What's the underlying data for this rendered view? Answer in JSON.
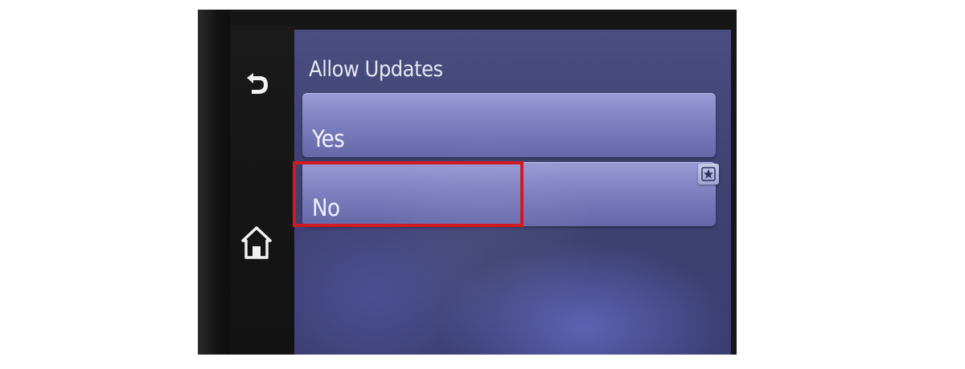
{
  "screen": {
    "title": "Allow Updates",
    "options": [
      {
        "label": "Yes",
        "selected": false
      },
      {
        "label": "No",
        "selected": true,
        "badge_icon": "star-icon"
      }
    ]
  },
  "nav": {
    "back_icon": "back-arrow-icon",
    "home_icon": "home-icon"
  },
  "annotation": {
    "highlight_color": "#d11a22",
    "highlighted_option": "No"
  },
  "colors": {
    "screen_bg": "#3f4272",
    "option_bg": "#7e80c0",
    "bezel": "#161616"
  }
}
